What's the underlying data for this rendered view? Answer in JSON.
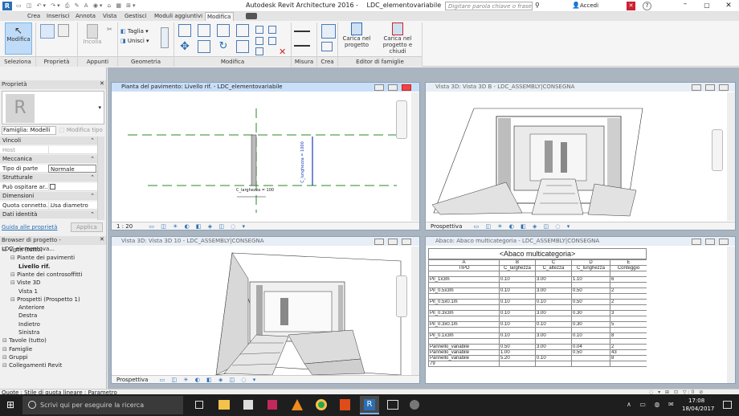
{
  "title": {
    "app": "Autodesk Revit Architecture 2016 -",
    "file": "LDC_elementovariabile",
    "search_placeholder": "Digitare parola chiave o frase",
    "signin": "Accedi"
  },
  "tabs": [
    "Crea",
    "Inserisci",
    "Annota",
    "Vista",
    "Gestisci",
    "Moduli aggiuntivi",
    "Modifica"
  ],
  "ribbon": {
    "modifica_label": "Modifica",
    "incolla_label": "Incolla",
    "taglia_label": "Taglia",
    "unisci_label": "Unisci",
    "carica_label": "Carica nel progetto",
    "carica_chiudi_label": "Carica nel progetto e chiudi",
    "groups": [
      "Seleziona",
      "Proprietà",
      "Appunti",
      "Geometria",
      "Modifica",
      "Misura",
      "Crea",
      "Editor di famiglie"
    ]
  },
  "properties": {
    "title": "Proprietà",
    "family": "Famiglia: Modelli",
    "edit_type": "Modifica tipo",
    "rows": [
      {
        "label": "Vincoli",
        "value": "",
        "section": true
      },
      {
        "label": "Host",
        "value": "",
        "section": false
      },
      {
        "label": "Meccanica",
        "value": "",
        "section": true
      },
      {
        "label": "Tipo di parte",
        "value": "Normale",
        "section": false
      },
      {
        "label": "Strutturale",
        "value": "",
        "section": true
      },
      {
        "label": "Può ospitare ar...",
        "value": "",
        "section": false
      },
      {
        "label": "Dimensioni",
        "value": "",
        "section": true
      },
      {
        "label": "Quota connetto...",
        "value": "Usa diametro",
        "section": false
      },
      {
        "label": "Dati identità",
        "value": "",
        "section": true
      }
    ],
    "help_link": "Guida alle proprietà",
    "apply": "Applica"
  },
  "browser": {
    "title": "Browser di progetto - LDC_elementova...",
    "items": [
      {
        "label": "Viste (tutto)",
        "indent": 0,
        "bold": false
      },
      {
        "label": "Piante dei pavimenti",
        "indent": 1,
        "bold": false
      },
      {
        "label": "Livello rif.",
        "indent": 2,
        "bold": true
      },
      {
        "label": "Piante dei controsoffitti",
        "indent": 1,
        "bold": false
      },
      {
        "label": "Viste 3D",
        "indent": 1,
        "bold": false
      },
      {
        "label": "Vista 1",
        "indent": 2,
        "bold": false
      },
      {
        "label": "Prospetti (Prospetto 1)",
        "indent": 1,
        "bold": false
      },
      {
        "label": "Anteriore",
        "indent": 2,
        "bold": false
      },
      {
        "label": "Destra",
        "indent": 2,
        "bold": false
      },
      {
        "label": "Indietro",
        "indent": 2,
        "bold": false
      },
      {
        "label": "Sinistra",
        "indent": 2,
        "bold": false
      },
      {
        "label": "Tavole (tutto)",
        "indent": 0,
        "bold": false
      },
      {
        "label": "Famiglie",
        "indent": 0,
        "bold": false
      },
      {
        "label": "Gruppi",
        "indent": 0,
        "bold": false
      },
      {
        "label": "Collegamenti Revit",
        "indent": 0,
        "bold": false
      }
    ]
  },
  "views": {
    "plan": {
      "title": "Pianta del pavimento: Livello rif. - LDC_elementovariabile",
      "scale": "1 : 20",
      "dim1": "C_larghezza = 100",
      "dim2": "C_lunghezza = 1000"
    },
    "v3d_b": {
      "title": "Vista 3D: Vista 3D B - LDC_ASSEMBLY|CONSEGNA",
      "footer": "Prospettiva"
    },
    "v3d_10": {
      "title": "Vista 3D: Vista 3D 10 - LDC_ASSEMBLY|CONSEGNA",
      "footer": "Prospettiva"
    },
    "schedule": {
      "title": "Abaco: Abaco multicategoria - LDC_ASSEMBLY|CONSEGNA"
    }
  },
  "schedule": {
    "heading": "<Abaco multicategoria>",
    "letters": [
      "A",
      "B",
      "C",
      "D",
      "E"
    ],
    "columns": [
      "TIPO",
      "C_larghezza",
      "C_altezza",
      "C_lunghezza",
      "Conteggio"
    ],
    "rows": [
      [
        "",
        "",
        "",
        "",
        ""
      ],
      [
        "Pil_1x3m",
        "0.10",
        "3.00",
        "1.10",
        "6"
      ],
      [
        "",
        "",
        "",
        "",
        ""
      ],
      [
        "Pil_0.5x3m",
        "0.10",
        "3.00",
        "0.50",
        "2"
      ],
      [
        "",
        "",
        "",
        "",
        ""
      ],
      [
        "Pil_0.5x0.1m",
        "0.10",
        "0.10",
        "0.50",
        "2"
      ],
      [
        "",
        "",
        "",
        "",
        ""
      ],
      [
        "Pil_0.3x3m",
        "0.10",
        "3.00",
        "0.30",
        "3"
      ],
      [
        "",
        "",
        "",
        "",
        ""
      ],
      [
        "Pil_0.3x0.1m",
        "0.10",
        "0.10",
        "0.30",
        "5"
      ],
      [
        "",
        "",
        "",
        "",
        ""
      ],
      [
        "Pil_0.1x3m",
        "0.10",
        "3.00",
        "0.10",
        "8"
      ],
      [
        "",
        "",
        "",
        "",
        ""
      ],
      [
        "Pannello_variabile",
        "0.50",
        "3.00",
        "0.04",
        "2"
      ],
      [
        "Pannello_variabile",
        "1.00",
        "",
        "0.50",
        "43"
      ],
      [
        "Pannello_variabile",
        "5.20",
        "0.10",
        "",
        "8"
      ],
      [
        "79",
        "",
        "",
        "",
        ""
      ]
    ]
  },
  "status": {
    "text": "Quote : Stile di quota lineare : Parametro"
  },
  "taskbar": {
    "search": "Scrivi qui per eseguire la ricerca",
    "time": "17:08",
    "date": "18/04/2017"
  }
}
